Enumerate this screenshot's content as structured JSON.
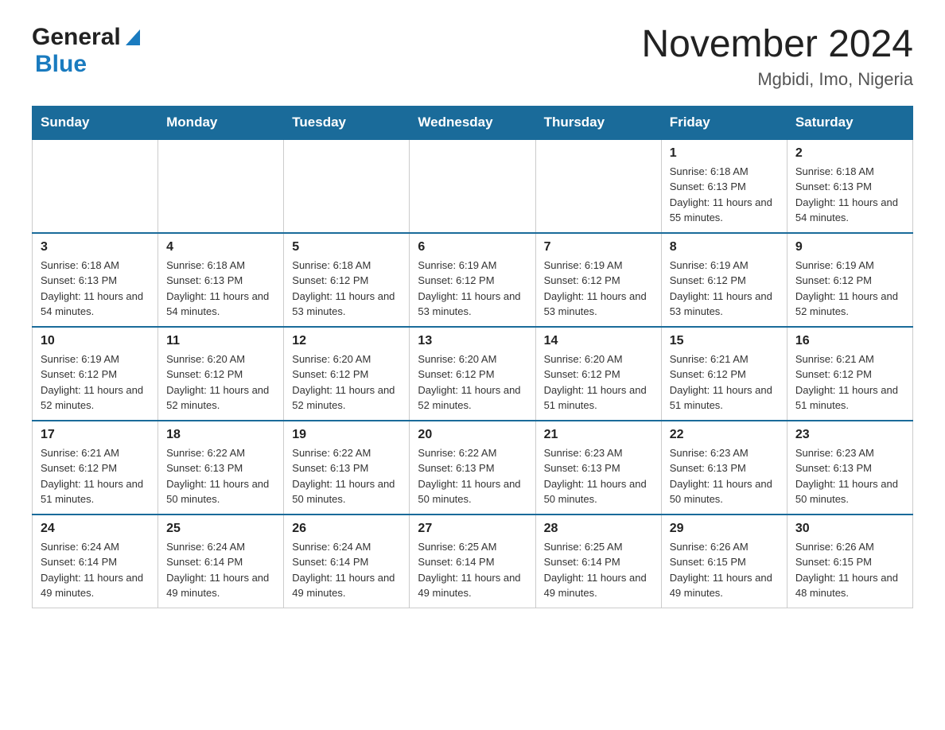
{
  "header": {
    "logo_general": "General",
    "logo_blue": "Blue",
    "month_title": "November 2024",
    "location": "Mgbidi, Imo, Nigeria"
  },
  "days_of_week": [
    "Sunday",
    "Monday",
    "Tuesday",
    "Wednesday",
    "Thursday",
    "Friday",
    "Saturday"
  ],
  "weeks": [
    [
      {
        "day": "",
        "info": ""
      },
      {
        "day": "",
        "info": ""
      },
      {
        "day": "",
        "info": ""
      },
      {
        "day": "",
        "info": ""
      },
      {
        "day": "",
        "info": ""
      },
      {
        "day": "1",
        "info": "Sunrise: 6:18 AM\nSunset: 6:13 PM\nDaylight: 11 hours and 55 minutes."
      },
      {
        "day": "2",
        "info": "Sunrise: 6:18 AM\nSunset: 6:13 PM\nDaylight: 11 hours and 54 minutes."
      }
    ],
    [
      {
        "day": "3",
        "info": "Sunrise: 6:18 AM\nSunset: 6:13 PM\nDaylight: 11 hours and 54 minutes."
      },
      {
        "day": "4",
        "info": "Sunrise: 6:18 AM\nSunset: 6:13 PM\nDaylight: 11 hours and 54 minutes."
      },
      {
        "day": "5",
        "info": "Sunrise: 6:18 AM\nSunset: 6:12 PM\nDaylight: 11 hours and 53 minutes."
      },
      {
        "day": "6",
        "info": "Sunrise: 6:19 AM\nSunset: 6:12 PM\nDaylight: 11 hours and 53 minutes."
      },
      {
        "day": "7",
        "info": "Sunrise: 6:19 AM\nSunset: 6:12 PM\nDaylight: 11 hours and 53 minutes."
      },
      {
        "day": "8",
        "info": "Sunrise: 6:19 AM\nSunset: 6:12 PM\nDaylight: 11 hours and 53 minutes."
      },
      {
        "day": "9",
        "info": "Sunrise: 6:19 AM\nSunset: 6:12 PM\nDaylight: 11 hours and 52 minutes."
      }
    ],
    [
      {
        "day": "10",
        "info": "Sunrise: 6:19 AM\nSunset: 6:12 PM\nDaylight: 11 hours and 52 minutes."
      },
      {
        "day": "11",
        "info": "Sunrise: 6:20 AM\nSunset: 6:12 PM\nDaylight: 11 hours and 52 minutes."
      },
      {
        "day": "12",
        "info": "Sunrise: 6:20 AM\nSunset: 6:12 PM\nDaylight: 11 hours and 52 minutes."
      },
      {
        "day": "13",
        "info": "Sunrise: 6:20 AM\nSunset: 6:12 PM\nDaylight: 11 hours and 52 minutes."
      },
      {
        "day": "14",
        "info": "Sunrise: 6:20 AM\nSunset: 6:12 PM\nDaylight: 11 hours and 51 minutes."
      },
      {
        "day": "15",
        "info": "Sunrise: 6:21 AM\nSunset: 6:12 PM\nDaylight: 11 hours and 51 minutes."
      },
      {
        "day": "16",
        "info": "Sunrise: 6:21 AM\nSunset: 6:12 PM\nDaylight: 11 hours and 51 minutes."
      }
    ],
    [
      {
        "day": "17",
        "info": "Sunrise: 6:21 AM\nSunset: 6:12 PM\nDaylight: 11 hours and 51 minutes."
      },
      {
        "day": "18",
        "info": "Sunrise: 6:22 AM\nSunset: 6:13 PM\nDaylight: 11 hours and 50 minutes."
      },
      {
        "day": "19",
        "info": "Sunrise: 6:22 AM\nSunset: 6:13 PM\nDaylight: 11 hours and 50 minutes."
      },
      {
        "day": "20",
        "info": "Sunrise: 6:22 AM\nSunset: 6:13 PM\nDaylight: 11 hours and 50 minutes."
      },
      {
        "day": "21",
        "info": "Sunrise: 6:23 AM\nSunset: 6:13 PM\nDaylight: 11 hours and 50 minutes."
      },
      {
        "day": "22",
        "info": "Sunrise: 6:23 AM\nSunset: 6:13 PM\nDaylight: 11 hours and 50 minutes."
      },
      {
        "day": "23",
        "info": "Sunrise: 6:23 AM\nSunset: 6:13 PM\nDaylight: 11 hours and 50 minutes."
      }
    ],
    [
      {
        "day": "24",
        "info": "Sunrise: 6:24 AM\nSunset: 6:14 PM\nDaylight: 11 hours and 49 minutes."
      },
      {
        "day": "25",
        "info": "Sunrise: 6:24 AM\nSunset: 6:14 PM\nDaylight: 11 hours and 49 minutes."
      },
      {
        "day": "26",
        "info": "Sunrise: 6:24 AM\nSunset: 6:14 PM\nDaylight: 11 hours and 49 minutes."
      },
      {
        "day": "27",
        "info": "Sunrise: 6:25 AM\nSunset: 6:14 PM\nDaylight: 11 hours and 49 minutes."
      },
      {
        "day": "28",
        "info": "Sunrise: 6:25 AM\nSunset: 6:14 PM\nDaylight: 11 hours and 49 minutes."
      },
      {
        "day": "29",
        "info": "Sunrise: 6:26 AM\nSunset: 6:15 PM\nDaylight: 11 hours and 49 minutes."
      },
      {
        "day": "30",
        "info": "Sunrise: 6:26 AM\nSunset: 6:15 PM\nDaylight: 11 hours and 48 minutes."
      }
    ]
  ]
}
